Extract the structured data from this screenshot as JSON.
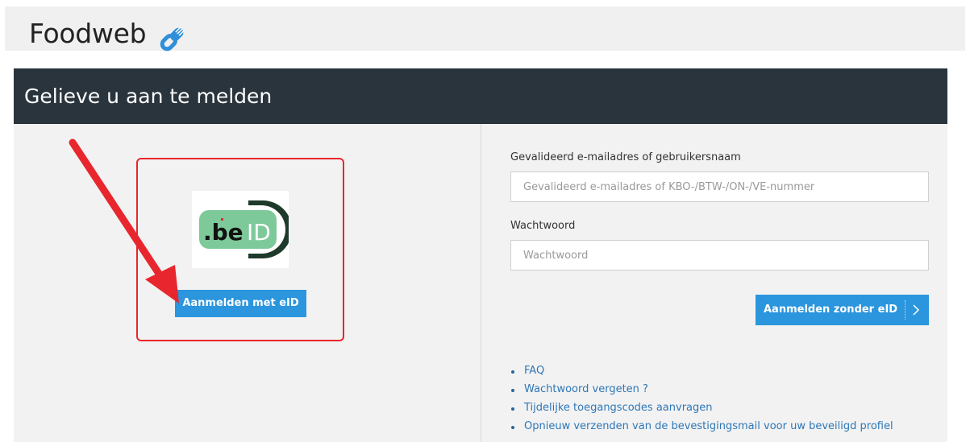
{
  "header": {
    "brand": "Foodweb",
    "brand_icon": "fork-link-icon",
    "brand_icon_color": "#2f8fd8"
  },
  "panel": {
    "title": "Gelieve u aan te melden",
    "header_color": "#2a343d"
  },
  "eid": {
    "logo_icon": "beid-logo-icon",
    "logo_text_be": ".be",
    "logo_text_id": "ID",
    "button_label": "Aanmelden met eID",
    "highlight_color": "#e8262d",
    "arrow_color": "#e8262d"
  },
  "login": {
    "username_label": "Gevalideerd e-mailadres of gebruikersnaam",
    "username_placeholder": "Gevalideerd e-mailadres of KBO-/BTW-/ON-/VE-nummer",
    "username_value": "",
    "password_label": "Wachtwoord",
    "password_placeholder": "Wachtwoord",
    "password_value": "",
    "submit_label": "Aanmelden zonder eID",
    "submit_icon": "chevron-right-icon",
    "accent_color": "#2b95dd"
  },
  "links": [
    {
      "label": "FAQ"
    },
    {
      "label": "Wachtwoord vergeten ?"
    },
    {
      "label": "Tijdelijke toegangscodes aanvragen"
    },
    {
      "label": "Opnieuw verzenden van de bevestigingsmail voor uw beveiligd profiel"
    }
  ]
}
